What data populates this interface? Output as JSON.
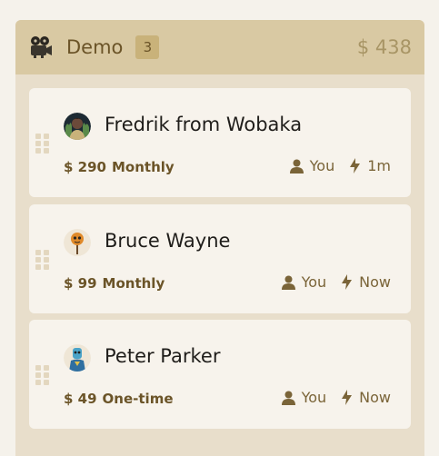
{
  "column": {
    "title": "Demo",
    "count": "3",
    "total": "$ 438",
    "icon": "film-projector-icon"
  },
  "cards": [
    {
      "name": "Fredrik from Wobaka",
      "price": "$ 290",
      "frequency": "Monthly",
      "owner": "You",
      "time": "1m",
      "avatar": "avatar-fredrik"
    },
    {
      "name": "Bruce Wayne",
      "price": "$ 99",
      "frequency": "Monthly",
      "owner": "You",
      "time": "Now",
      "avatar": "avatar-bruce"
    },
    {
      "name": "Peter Parker",
      "price": "$ 49",
      "frequency": "One-time",
      "owner": "You",
      "time": "Now",
      "avatar": "avatar-peter"
    }
  ],
  "colors": {
    "column_bg": "#e8decb",
    "header_bg": "#d9c9a3",
    "card_bg": "#f7f3ec",
    "accent_text": "#6b5428"
  }
}
